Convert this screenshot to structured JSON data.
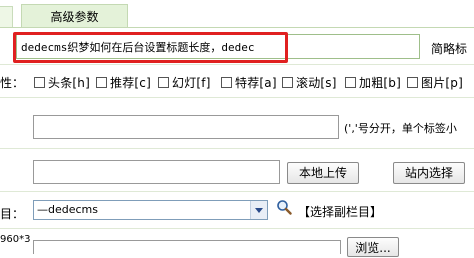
{
  "tabs": {
    "advanced": "高级参数"
  },
  "title": {
    "value": "dedecms织梦如何在后台设置标题长度，dedec",
    "short_title_label": "简略标"
  },
  "attributes": {
    "label": "性：",
    "items": [
      {
        "label": "头条[h]"
      },
      {
        "label": "推荐[c]"
      },
      {
        "label": "幻灯[f]"
      },
      {
        "label": "特荐[a]"
      },
      {
        "label": "滚动[s]"
      },
      {
        "label": "加粗[b]"
      },
      {
        "label": "图片[p]"
      }
    ]
  },
  "tags": {
    "value": "",
    "hint": "(','号分开，单个标签小"
  },
  "thumbnail": {
    "value": "",
    "upload_label": "本地上传",
    "site_select_label": "站内选择"
  },
  "column": {
    "label": "目：",
    "selected": "—dedecms",
    "sub_column_link": "【选择副栏目】",
    "search_icon": "magnifier-icon"
  },
  "bottom": {
    "dim_text": "960*3",
    "browse_label": "浏览..."
  }
}
